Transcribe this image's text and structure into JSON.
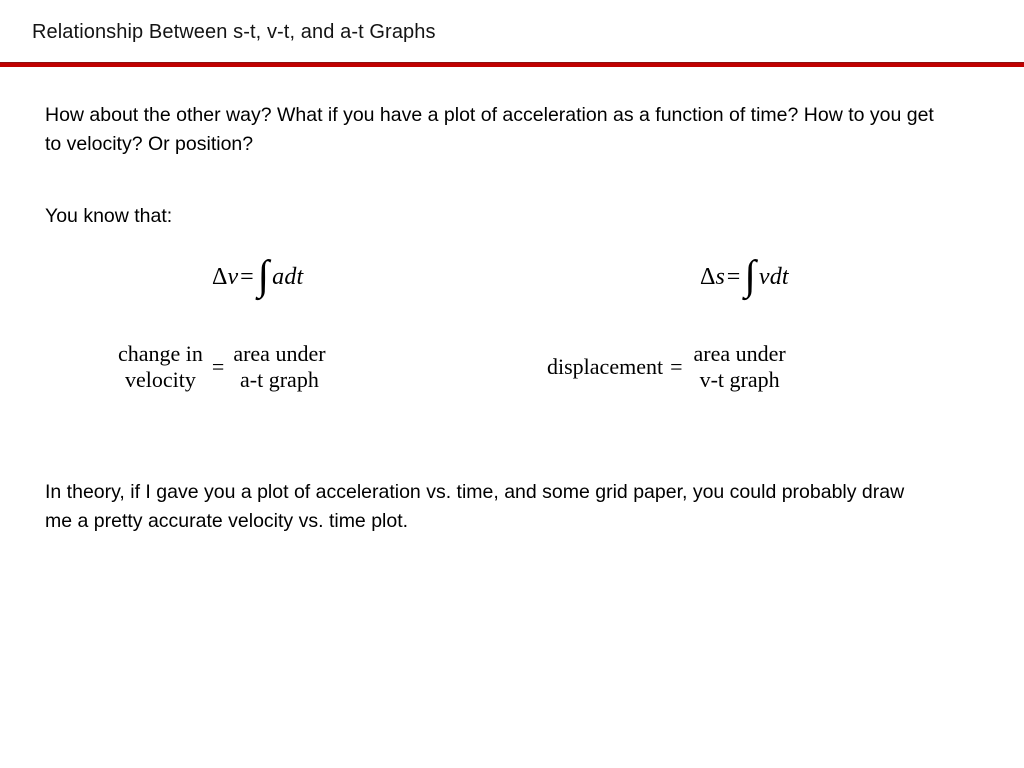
{
  "slide": {
    "title": "Relationship Between s-t, v-t, and a-t Graphs",
    "rule_color": "#c00000",
    "background_color": "#ffffff",
    "text_color": "#000000"
  },
  "body": {
    "intro_paragraph": "How about the other way? What if you have a plot of acceleration as a function of time? How to you get to velocity? Or position?",
    "lead_in": "You know that:",
    "closing_paragraph": "In theory, if I gave you a plot of acceleration vs. time, and some grid paper, you could probably draw me a pretty accurate velocity vs. time plot."
  },
  "equations": {
    "velocity": {
      "delta": "Δ",
      "variable": "v",
      "equals": "=",
      "integral": "∫",
      "integrand": "adt",
      "plain": "Δv = ∫ a dt"
    },
    "displacement": {
      "delta": "Δ",
      "variable": "s",
      "equals": "=",
      "integral": "∫",
      "integrand": "vdt",
      "plain": "Δs = ∫ v dt"
    }
  },
  "word_equations": {
    "left": {
      "lhs_line1": "change in",
      "lhs_line2": "velocity",
      "equals": "=",
      "rhs_line1": "area under",
      "rhs_line2": "a-t graph",
      "plain": "change in velocity = area under a-t graph"
    },
    "right": {
      "lhs": "displacement",
      "equals": "=",
      "rhs_line1": "area under",
      "rhs_line2": "v-t graph",
      "plain": "displacement = area under v-t graph"
    }
  }
}
